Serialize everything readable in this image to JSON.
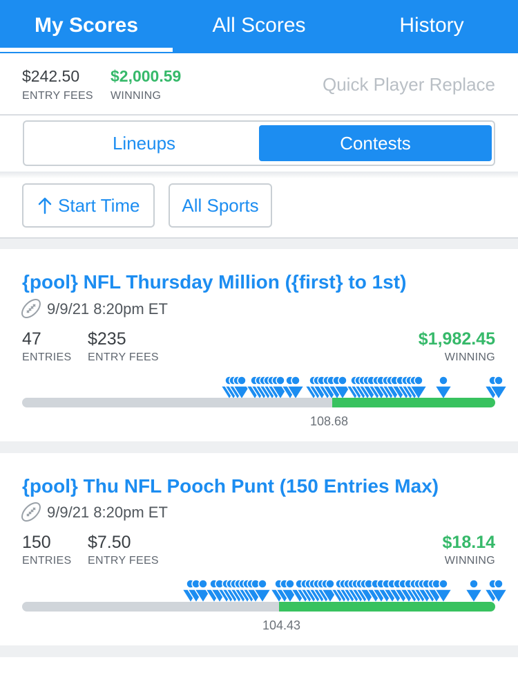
{
  "tabs": [
    {
      "label": "My Scores",
      "active": true
    },
    {
      "label": "All Scores",
      "active": false
    },
    {
      "label": "History",
      "active": false
    }
  ],
  "summary": {
    "entry_fees_value": "$242.50",
    "entry_fees_label": "ENTRY FEES",
    "winning_value": "$2,000.59",
    "winning_label": "WINNING",
    "quick_replace_label": "Quick Player Replace"
  },
  "segment": {
    "left_label": "Lineups",
    "right_label": "Contests",
    "selected": "Contests"
  },
  "filters": {
    "sort_label": "Start Time",
    "sport_label": "All Sports"
  },
  "contests": [
    {
      "title": "{pool} NFL Thursday Million ({first} to 1st)",
      "date": "9/9/21 8:20pm ET",
      "entries": "47",
      "entries_label": "ENTRIES",
      "entry_fees": "$235",
      "entry_fees_label": "ENTRY FEES",
      "winning": "$1,982.45",
      "winning_label": "WINNING",
      "score": "108.68",
      "progress_fraction": 0.656
    },
    {
      "title": "{pool} Thu NFL Pooch Punt (150 Entries Max)",
      "date": "9/9/21 8:20pm ET",
      "entries": "150",
      "entries_label": "ENTRIES",
      "entry_fees": "$7.50",
      "entry_fees_label": "ENTRY FEES",
      "winning": "$18.14",
      "winning_label": "WINNING",
      "score": "104.43",
      "progress_fraction": 0.548
    }
  ],
  "colors": {
    "brand_blue": "#1c8df1",
    "win_green": "#36b96a",
    "bar_green": "#38c25f",
    "bar_grey": "#d0d5da"
  },
  "icons": {
    "sort": "arrow-up-icon",
    "sport": "football-icon",
    "lineup_marker": "person-marker-icon"
  }
}
